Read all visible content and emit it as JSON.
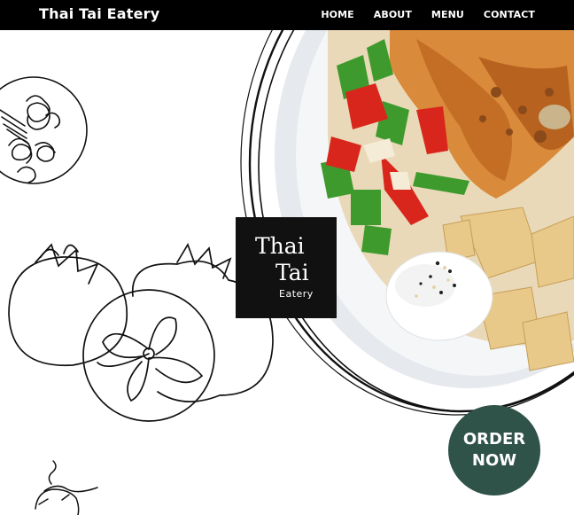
{
  "header": {
    "brand": "Thai Tai Eatery",
    "nav": [
      "HOME",
      "ABOUT",
      "MENU",
      "CONTACT"
    ]
  },
  "logo": {
    "line1": "Thai",
    "line2": "Tai",
    "line3": "Eatery"
  },
  "cta": {
    "line1": "ORDER",
    "line2": "NOW"
  },
  "colors": {
    "topbar": "#000000",
    "cta_bg": "#2f5249",
    "logo_bg": "#111111"
  }
}
